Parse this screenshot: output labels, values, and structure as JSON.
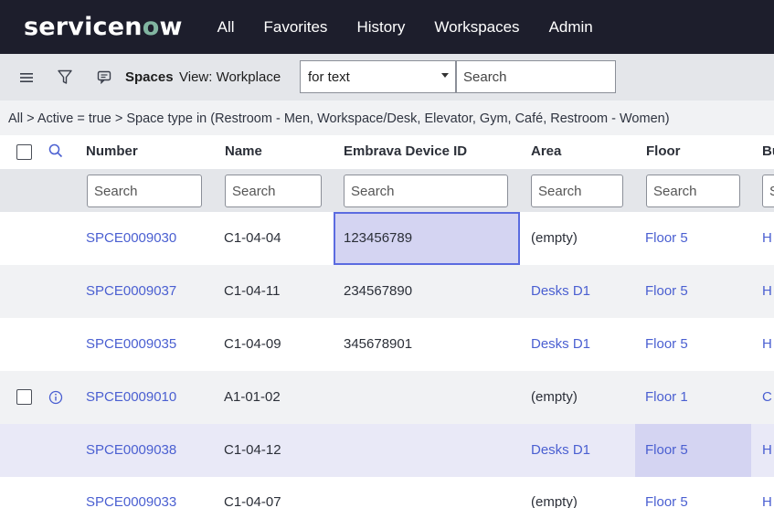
{
  "nav": {
    "logo_pre": "servicen",
    "logo_o": "o",
    "logo_post": "w",
    "links": [
      "All",
      "Favorites",
      "History",
      "Workspaces",
      "Admin"
    ]
  },
  "toolbar": {
    "table_name": "Spaces",
    "view_label": "View: Workplace",
    "select_value": "for text",
    "search_placeholder": "Search"
  },
  "breadcrumb": "All > Active = true > Space type in (Restroom - Men, Workspace/Desk, Elevator, Gym, Café, Restroom - Women)",
  "columns": [
    "Number",
    "Name",
    "Embrava Device ID",
    "Area",
    "Floor",
    "Bu"
  ],
  "filter_placeholders": [
    "Search",
    "Search",
    "Search",
    "Search",
    "Search",
    "S"
  ],
  "rows": [
    {
      "number": "SPCE0009030",
      "name": "C1-04-04",
      "device_id": "123456789",
      "area": "(empty)",
      "floor": "Floor 5",
      "bu": "H"
    },
    {
      "number": "SPCE0009037",
      "name": "C1-04-11",
      "device_id": "234567890",
      "area": "Desks D1",
      "floor": "Floor 5",
      "bu": "H"
    },
    {
      "number": "SPCE0009035",
      "name": "C1-04-09",
      "device_id": "345678901",
      "area": "Desks D1",
      "floor": "Floor 5",
      "bu": "H"
    },
    {
      "number": "SPCE0009010",
      "name": "A1-01-02",
      "device_id": "",
      "area": "(empty)",
      "floor": "Floor 1",
      "bu": "C"
    },
    {
      "number": "SPCE0009038",
      "name": "C1-04-12",
      "device_id": "",
      "area": "Desks D1",
      "floor": "Floor 5",
      "bu": "H"
    },
    {
      "number": "SPCE0009033",
      "name": "C1-04-07",
      "device_id": "",
      "area": "(empty)",
      "floor": "Floor 5",
      "bu": "H"
    }
  ],
  "colors": {
    "nav_bg": "#1d1e2c",
    "link": "#4a5fd1",
    "logo_accent": "#81b5a1",
    "highlight": "#d4d4f2"
  }
}
